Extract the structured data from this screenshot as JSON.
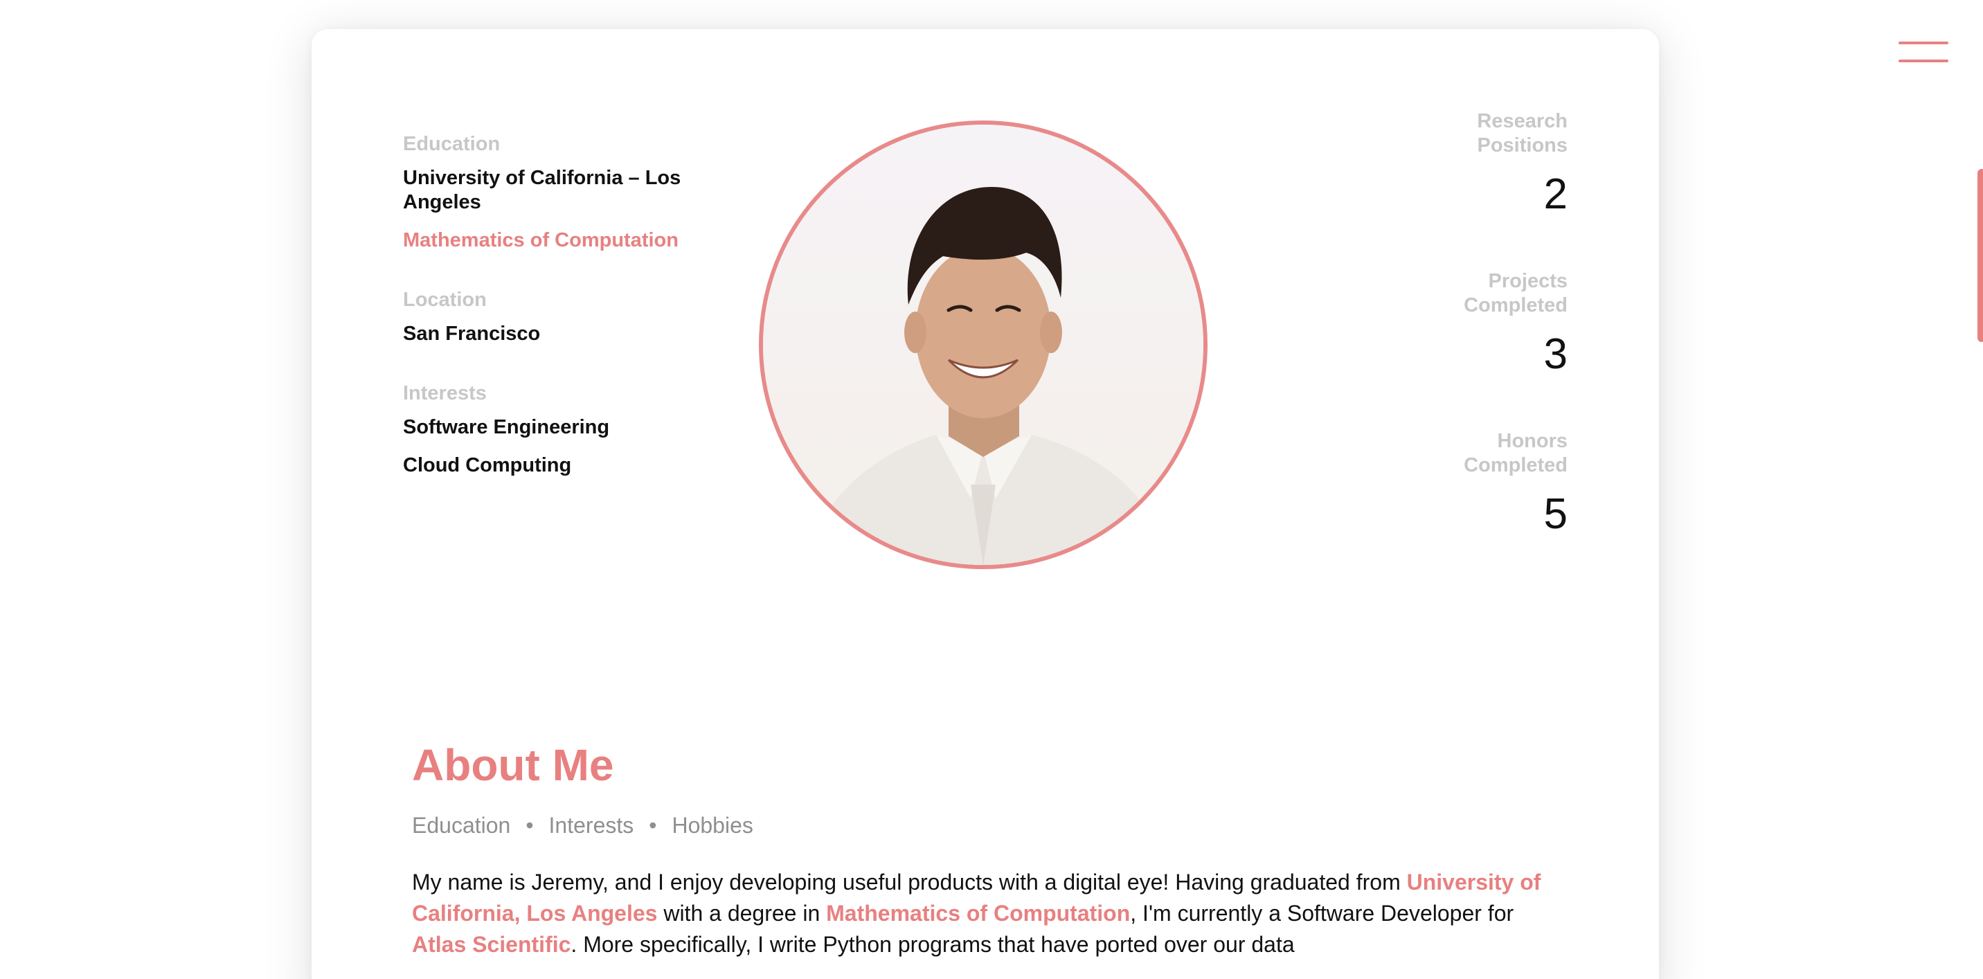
{
  "profile": {
    "education_label": "Education",
    "education_school": "University of California – Los Angeles",
    "education_major": "Mathematics of Computation",
    "location_label": "Location",
    "location_value": "San Francisco",
    "interests_label": "Interests",
    "interests": [
      "Software Engineering",
      "Cloud Computing"
    ]
  },
  "stats": [
    {
      "label": "Research Positions",
      "value": "2"
    },
    {
      "label": "Projects Completed",
      "value": "3"
    },
    {
      "label": "Honors Completed",
      "value": "5"
    }
  ],
  "about": {
    "title": "About Me",
    "tags": [
      "Education",
      "Interests",
      "Hobbies"
    ],
    "tag_separator": "•",
    "body": {
      "part1": "My name is Jeremy, and I enjoy developing useful products with a digital eye! Having graduated from ",
      "link1": "University of California, Los Angeles",
      "part2": " with a degree in ",
      "link2": "Mathematics of Computation",
      "part3": ", I'm currently a Software Developer for ",
      "link3": "Atlas Scientific",
      "part4": ". More specifically, I write Python programs that have ported over our data"
    }
  },
  "icons": {
    "menu": "hamburger-menu-icon",
    "avatar": "profile-photo"
  },
  "colors": {
    "accent": "#e88080",
    "label_gray": "#c7c7c7",
    "text": "#111111",
    "muted": "#8f8f8f"
  }
}
